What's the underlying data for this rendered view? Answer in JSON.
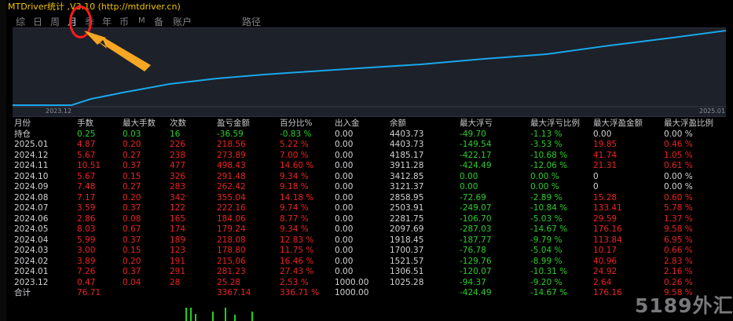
{
  "window_title": "MTDriver统计 ,V3.10 (http://mtdriver.cn)",
  "tabs": [
    "综",
    "日",
    "周",
    "月",
    "季",
    "年",
    "币",
    "M",
    "备",
    "账户",
    "路径"
  ],
  "active_tab": "月",
  "chart": {
    "x_start_label": "2023.12",
    "x_end_label": "2025.01",
    "line_color": "#1aa7ea"
  },
  "table": {
    "headers": [
      "月份",
      "手数",
      "最大手数",
      "次数",
      "盈亏金额",
      "百分比%",
      "出入金",
      "余额",
      "最大浮亏",
      "最大浮亏比例",
      "最大浮盈金额",
      "最大浮盈比例"
    ],
    "holding": [
      "持仓",
      "0.25",
      "0.03",
      "16",
      "-36.59",
      "-0.83 %",
      "0.00",
      "4403.73",
      "-49.70",
      "-1.13 %",
      "0.00",
      "0.00 %"
    ],
    "rows": [
      [
        "2025.01",
        "4.87",
        "0.20",
        "226",
        "218.56",
        "5.22 %",
        "0.00",
        "4403.73",
        "-149.54",
        "-3.53 %",
        "19.85",
        "0.46 %"
      ],
      [
        "2024.12",
        "5.67",
        "0.27",
        "238",
        "273.89",
        "7.00 %",
        "0.00",
        "4185.17",
        "-422.17",
        "-10.68 %",
        "41.74",
        "1.05 %"
      ],
      [
        "2024.11",
        "10.51",
        "0.37",
        "477",
        "498.43",
        "14.60 %",
        "0.00",
        "3911.28",
        "-424.49",
        "-12.06 %",
        "21.31",
        "0.61 %"
      ],
      [
        "2024.10",
        "5.67",
        "0.15",
        "326",
        "291.48",
        "9.34 %",
        "0.00",
        "3412.85",
        "0.00",
        "0.00 %",
        "0",
        "0.00 %"
      ],
      [
        "2024.09",
        "7.48",
        "0.27",
        "283",
        "262.42",
        "9.18 %",
        "0.00",
        "3121.37",
        "0.00",
        "0.00 %",
        "0",
        "0.00 %"
      ],
      [
        "2024.08",
        "7.17",
        "0.20",
        "342",
        "355.04",
        "14.18 %",
        "0.00",
        "2858.95",
        "-72.69",
        "-2.89 %",
        "15.28",
        "0.60 %"
      ],
      [
        "2024.07",
        "3.59",
        "0.37",
        "122",
        "222.16",
        "9.74 %",
        "0.00",
        "2503.91",
        "-249.07",
        "-10.84 %",
        "133.41",
        "5.78 %"
      ],
      [
        "2024.06",
        "2.86",
        "0.08",
        "165",
        "184.06",
        "8.77 %",
        "0.00",
        "2281.75",
        "-106.70",
        "-5.03 %",
        "29.59",
        "1.37 %"
      ],
      [
        "2024.05",
        "8.03",
        "0.67",
        "174",
        "179.24",
        "9.34 %",
        "0.00",
        "2097.69",
        "-287.03",
        "-14.67 %",
        "176.16",
        "9.58 %"
      ],
      [
        "2024.04",
        "5.99",
        "0.37",
        "189",
        "218.08",
        "12.83 %",
        "0.00",
        "1918.45",
        "-187.77",
        "-9.79 %",
        "113.84",
        "6.95 %"
      ],
      [
        "2024.03",
        "3.00",
        "0.15",
        "123",
        "178.80",
        "11.75 %",
        "0.00",
        "1700.37",
        "-76.78",
        "-5.04 %",
        "10.17",
        "0.66 %"
      ],
      [
        "2024.02",
        "3.89",
        "0.20",
        "191",
        "215.06",
        "16.46 %",
        "0.00",
        "1521.57",
        "-129.76",
        "-8.99 %",
        "40.96",
        "2.83 %"
      ],
      [
        "2024.01",
        "7.26",
        "0.37",
        "291",
        "281.23",
        "27.43 %",
        "0.00",
        "1306.51",
        "-120.07",
        "-10.31 %",
        "24.92",
        "2.16 %"
      ],
      [
        "2023.12",
        "0.47",
        "0.04",
        "28",
        "25.28",
        "2.53 %",
        "1000.00",
        "1025.28",
        "-94.37",
        "-9.20 %",
        "2.64",
        "0.26 %"
      ]
    ],
    "total": [
      "合计",
      "76.71",
      "",
      "",
      "3367.14",
      "336.71 %",
      "1000.00",
      "",
      "-424.49",
      "-14.67 %",
      "176.16",
      "9.58 %"
    ]
  },
  "watermark": "5189外汇网",
  "colors": {
    "title": "#f2c500",
    "positive": "#ee2222",
    "negative": "#2dcc2d",
    "neutral": "#d2d2d6",
    "annotation": "#ff1a1a",
    "arrow": "#f5a623"
  }
}
